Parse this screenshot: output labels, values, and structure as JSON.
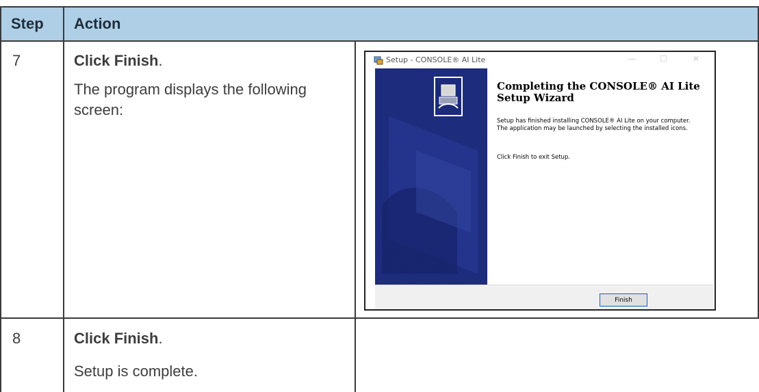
{
  "table": {
    "headers": {
      "step": "Step",
      "action": "Action"
    },
    "rows": [
      {
        "step": "7",
        "action_bold": "Click Finish",
        "action_suffix": ".",
        "description": "The program displays the following screen:"
      },
      {
        "step": "8",
        "action_bold": "Click Finish",
        "action_suffix": ".",
        "description": "Setup is complete."
      }
    ]
  },
  "installer": {
    "window_title": "Setup - CONSOLE® AI Lite",
    "heading": "Completing the CONSOLE® AI Lite Setup Wizard",
    "message": "Setup has finished installing CONSOLE® AI Lite on your computer. The application may be launched by selecting the installed icons.",
    "instruction": "Click Finish to exit Setup.",
    "finish_label": "Finish",
    "controls": {
      "minimize": "—",
      "maximize": "☐",
      "close": "✕"
    }
  },
  "colors": {
    "header_bg": "#aecfe6",
    "side_panel": "#1b2a79"
  }
}
